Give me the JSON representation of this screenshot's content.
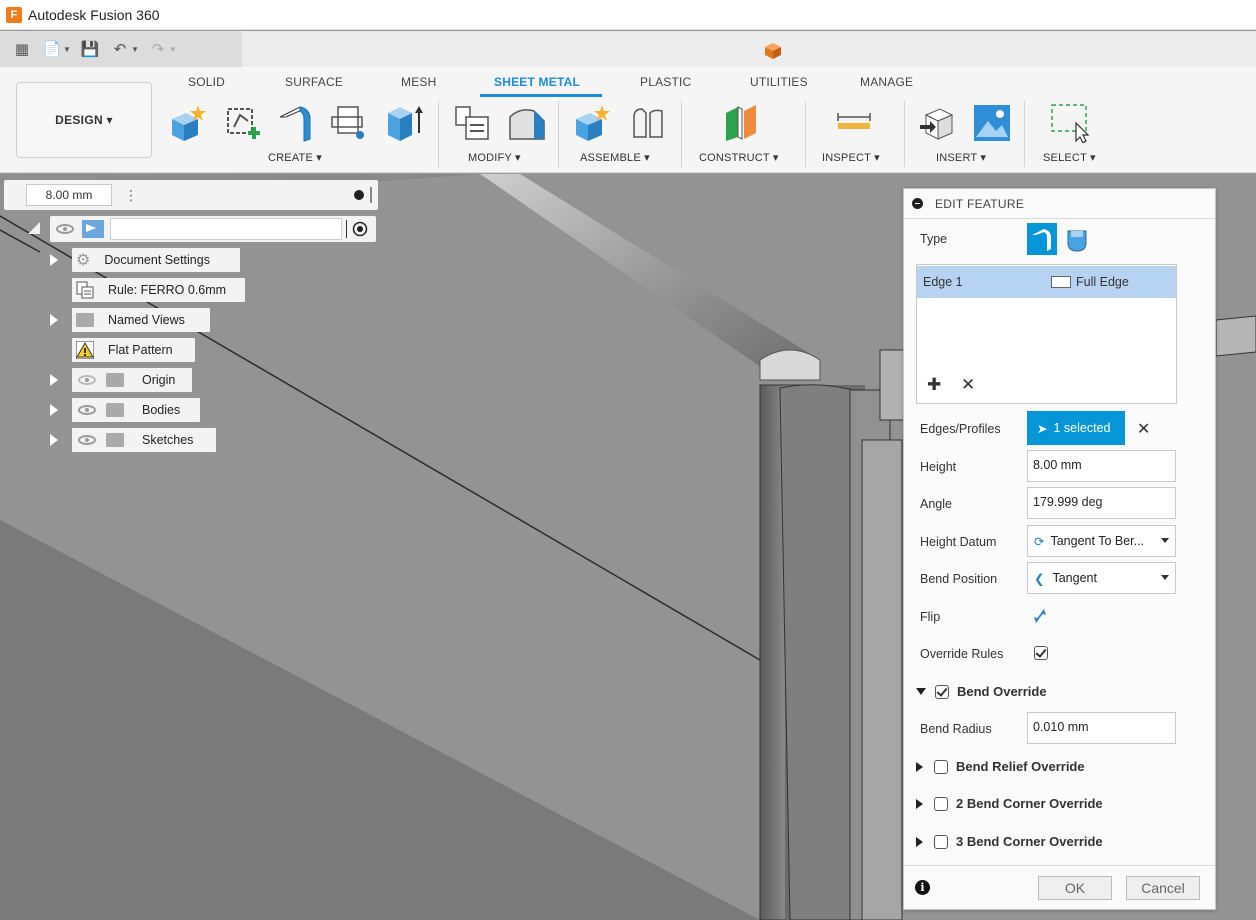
{
  "titlebar": {
    "title": "Autodesk Fusion 360",
    "logo_letter": "F"
  },
  "toolbar": {
    "workspace": "DESIGN ▾",
    "tabs": [
      "SOLID",
      "SURFACE",
      "MESH",
      "SHEET METAL",
      "PLASTIC",
      "UTILITIES",
      "MANAGE"
    ],
    "active_tab": "SHEET METAL",
    "groups": [
      "CREATE ▾",
      "MODIFY ▾",
      "ASSEMBLE ▾",
      "CONSTRUCT ▾",
      "INSPECT ▾",
      "INSERT ▾",
      "SELECT ▾"
    ],
    "accent_color": "#1a8cd8"
  },
  "browser": {
    "dimension_value": "8.00 mm",
    "items": [
      {
        "label": "Document Settings",
        "icon": "gear-icon"
      },
      {
        "label": "Rule: FERRO 0.6mm",
        "icon": "rule-icon"
      },
      {
        "label": "Named Views",
        "icon": "folder-icon"
      },
      {
        "label": "Flat Pattern",
        "icon": "warning-icon"
      },
      {
        "label": "Origin",
        "icon": "folder-icon"
      },
      {
        "label": "Bodies",
        "icon": "folder-icon"
      },
      {
        "label": "Sketches",
        "icon": "folder-icon"
      }
    ]
  },
  "edit_feature": {
    "title": "EDIT FEATURE",
    "type_label": "Type",
    "edge_list": {
      "edge_name": "Edge 1",
      "edge_type": "Full Edge"
    },
    "edges_profiles": {
      "label": "Edges/Profiles",
      "value": "1 selected"
    },
    "height": {
      "label": "Height",
      "value": "8.00 mm"
    },
    "angle": {
      "label": "Angle",
      "value": "179.999 deg"
    },
    "height_datum": {
      "label": "Height Datum",
      "value": "Tangent To Ber..."
    },
    "bend_position": {
      "label": "Bend Position",
      "value": "Tangent"
    },
    "flip": {
      "label": "Flip"
    },
    "override_rules": {
      "label": "Override Rules",
      "checked": true
    },
    "bend_override": {
      "label": "Bend Override",
      "checked": true,
      "expanded": true
    },
    "bend_radius": {
      "label": "Bend Radius",
      "value": "0.010 mm"
    },
    "bend_relief_override": {
      "label": "Bend Relief Override",
      "checked": false
    },
    "two_bend_corner_override": {
      "label": "2 Bend Corner Override",
      "checked": false
    },
    "three_bend_corner_override": {
      "label": "3 Bend Corner Override",
      "checked": false
    },
    "ok_label": "OK",
    "cancel_label": "Cancel",
    "selection_color": "#0696d7"
  }
}
